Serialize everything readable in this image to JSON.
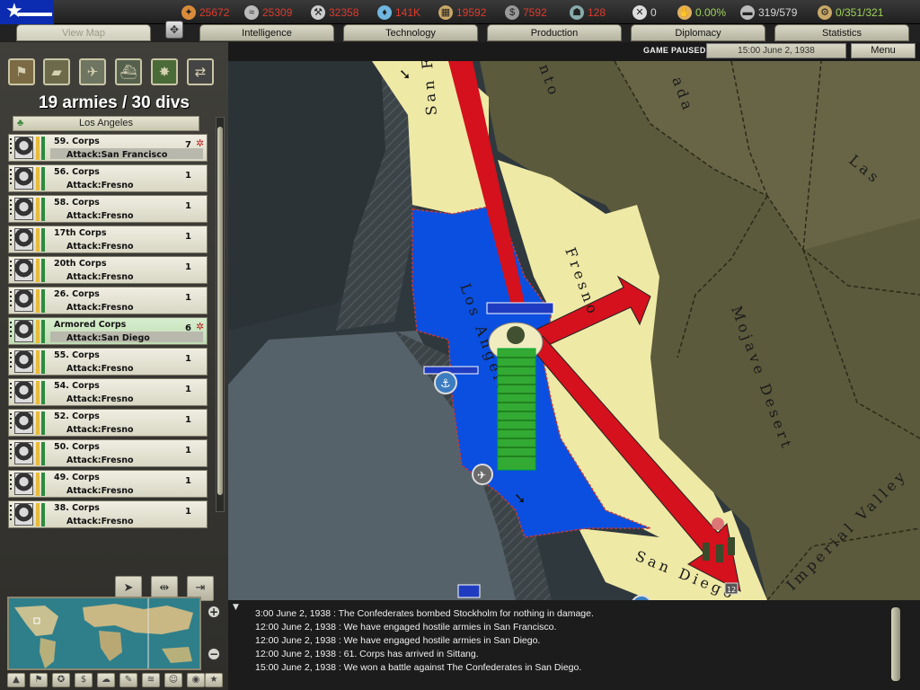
{
  "resources": [
    {
      "icon": "energy-icon",
      "value": "25672",
      "style": "red"
    },
    {
      "icon": "metal-icon",
      "value": "25309",
      "style": "red"
    },
    {
      "icon": "rare-materials-icon",
      "value": "32358",
      "style": "red"
    },
    {
      "icon": "oil-icon",
      "value": "141K",
      "style": "red"
    },
    {
      "icon": "supplies-icon",
      "value": "19592",
      "style": "red"
    },
    {
      "icon": "money-icon",
      "value": "7592",
      "style": "red"
    },
    {
      "icon": "manpower-icon",
      "value": "128",
      "style": "red"
    },
    {
      "icon": "transports-icon",
      "value": "0",
      "style": "ok"
    },
    {
      "icon": "dissent-icon",
      "value": "0.00%",
      "style": "green"
    },
    {
      "icon": "convoy-icon",
      "value": "319/579",
      "style": "ok"
    },
    {
      "icon": "ic-icon",
      "value": "0/351/321",
      "style": "green"
    }
  ],
  "tabs": {
    "viewmap": "View Map",
    "intelligence": "Intelligence",
    "technology": "Technology",
    "production": "Production",
    "diplomacy": "Diplomacy",
    "statistics": "Statistics"
  },
  "status": {
    "paused": "GAME PAUSED",
    "date": "15:00 June 2, 1938",
    "menu": "Menu"
  },
  "panel": {
    "army_count": "19 armies / 30 divs",
    "hq_location": "Los Angeles"
  },
  "corps": [
    {
      "name": "59. Corps",
      "mission": "Attack:San Francisco",
      "count": "7",
      "highlight": true
    },
    {
      "name": "56. Corps",
      "mission": "Attack:Fresno",
      "count": "1"
    },
    {
      "name": "58. Corps",
      "mission": "Attack:Fresno",
      "count": "1"
    },
    {
      "name": "17th Corps",
      "mission": "Attack:Fresno",
      "count": "1"
    },
    {
      "name": "20th Corps",
      "mission": "Attack:Fresno",
      "count": "1"
    },
    {
      "name": "26. Corps",
      "mission": "Attack:Fresno",
      "count": "1"
    },
    {
      "name": "Armored Corps",
      "mission": "Attack:San Diego",
      "count": "6",
      "highlight": true,
      "selected": true
    },
    {
      "name": "55. Corps",
      "mission": "Attack:Fresno",
      "count": "1"
    },
    {
      "name": "54. Corps",
      "mission": "Attack:Fresno",
      "count": "1"
    },
    {
      "name": "52. Corps",
      "mission": "Attack:Fresno",
      "count": "1"
    },
    {
      "name": "50. Corps",
      "mission": "Attack:Fresno",
      "count": "1"
    },
    {
      "name": "49. Corps",
      "mission": "Attack:Fresno",
      "count": "1"
    },
    {
      "name": "38. Corps",
      "mission": "Attack:Fresno",
      "count": "1"
    }
  ],
  "map": {
    "provinces": [
      "San Francisco",
      "Fresno",
      "Los Angeles",
      "Mojave Desert",
      "San Diego",
      "Imperial Valley",
      "Las",
      "ada",
      "nto"
    ],
    "san_diego_unit_count": "12"
  },
  "log": [
    "3:00 June 2, 1938 : The Confederates bombed Stockholm for nothing in damage.",
    "12:00 June 2, 1938 : We have engaged hostile armies in San Francisco.",
    "12:00 June 2, 1938 : We have engaged hostile armies in San Diego.",
    "12:00 June 2, 1938 : 61. Corps has arrived in Sittang.",
    "15:00 June 2, 1938 : We won a battle against The Confederates in San Diego."
  ]
}
